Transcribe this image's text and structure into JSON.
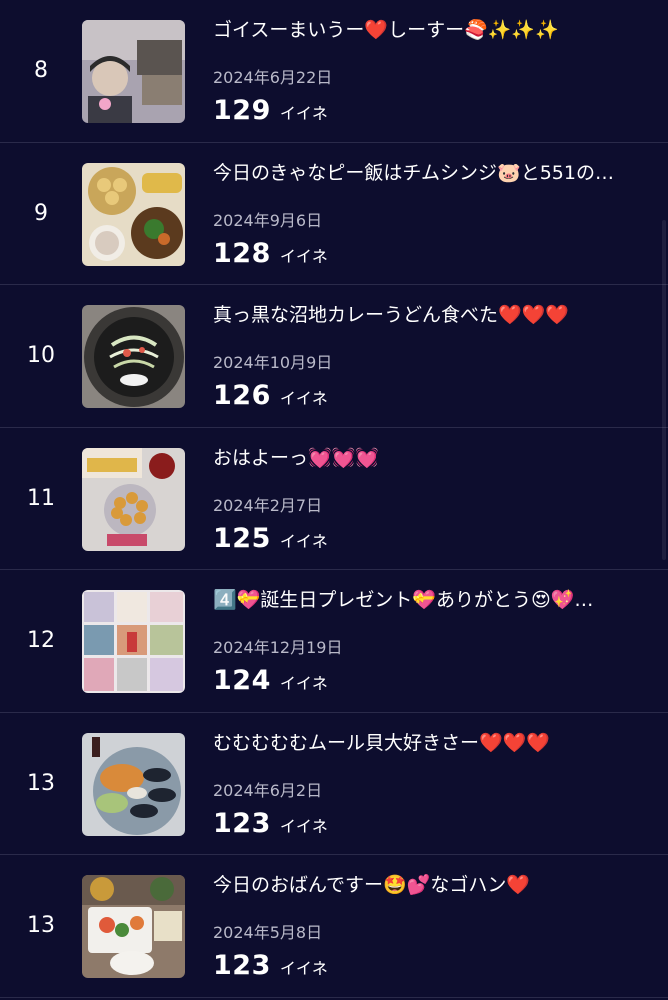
{
  "colors": {
    "background": "#0d0d2e",
    "divider": "#2a2a4a",
    "date_text": "#b9b9c9"
  },
  "likes_label": "イイネ",
  "items": [
    {
      "rank": "8",
      "title": "ゴイスーまいうー❤️しーすー🍣✨✨✨",
      "date": "2024年6月22日",
      "likes": "129",
      "thumb_icon": "photo-thumbnail-person"
    },
    {
      "rank": "9",
      "title": "今日のきゃなピー飯はチムシンジ🐷と551の…",
      "date": "2024年9月6日",
      "likes": "128",
      "thumb_icon": "photo-thumbnail-dimsum"
    },
    {
      "rank": "10",
      "title": "真っ黒な沼地カレーうどん食べた❤️❤️❤️",
      "date": "2024年10月9日",
      "likes": "126",
      "thumb_icon": "photo-thumbnail-curry-udon"
    },
    {
      "rank": "11",
      "title": "おはよーっ💓💓💓",
      "date": "2024年2月7日",
      "likes": "125",
      "thumb_icon": "photo-thumbnail-donut"
    },
    {
      "rank": "12",
      "title": "4️⃣💝誕生日プレゼント💝ありがとう😍💖…",
      "date": "2024年12月19日",
      "likes": "124",
      "thumb_icon": "photo-thumbnail-gifts"
    },
    {
      "rank": "13",
      "title": "むむむむむムール貝大好きさー❤️❤️❤️",
      "date": "2024年6月2日",
      "likes": "123",
      "thumb_icon": "photo-thumbnail-mussels"
    },
    {
      "rank": "13",
      "title": "今日のおばんですー🤩💕なゴハン❤️",
      "date": "2024年5月8日",
      "likes": "123",
      "thumb_icon": "photo-thumbnail-dinner"
    }
  ]
}
